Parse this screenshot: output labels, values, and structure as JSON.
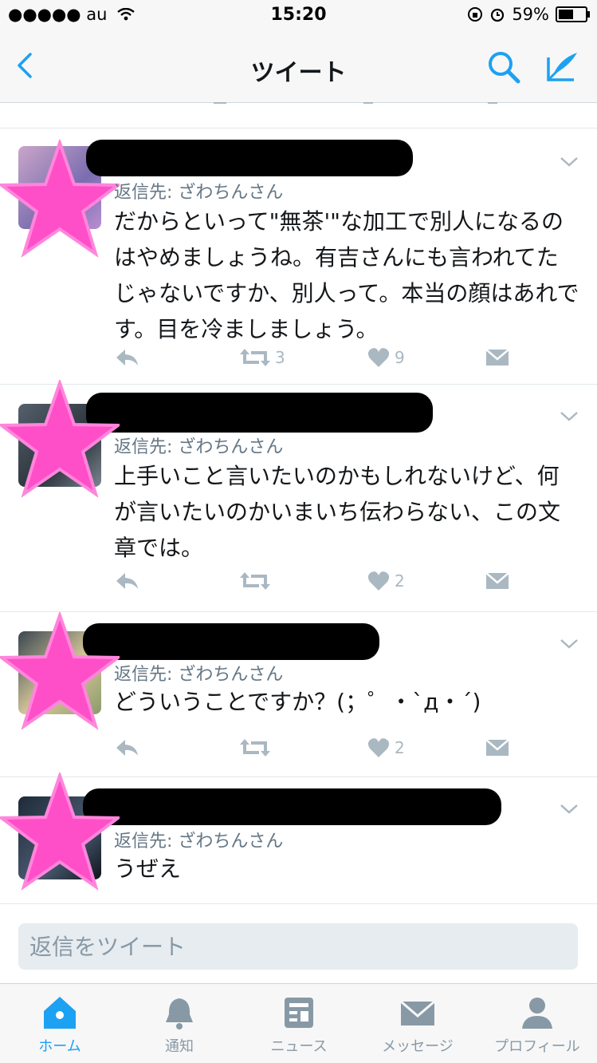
{
  "status": {
    "carrier": "●●●●● au",
    "time": "15:20",
    "battery": "59%",
    "battery_level": 0.59
  },
  "nav": {
    "title": "ツイート"
  },
  "tweets": [
    {
      "reply_to": "返信先: ざわちんさん",
      "text": "だからといって\"無茶'\"な加工で別人になるのはやめましょうね。有吉さんにも言われてたじゃないですか、別人って。本当の顔はあれです。目を冷ましましょう。",
      "retweets": "3",
      "likes": "9"
    },
    {
      "reply_to": "返信先: ざわちんさん",
      "text": "上手いこと言いたいのかもしれないけど、何が言いたいのかいまいち伝わらない、この文章では。",
      "retweets": "",
      "likes": "2"
    },
    {
      "reply_to": "返信先: ざわちんさん",
      "text": "どういうことですか？(；゜・`д・´)",
      "retweets": "",
      "likes": "2"
    },
    {
      "reply_to": "返信先: ざわちんさん",
      "text": "うぜえ",
      "retweets": "",
      "likes": ""
    }
  ],
  "reply_box": {
    "placeholder": "返信をツイート"
  },
  "tabs": [
    {
      "label": "ホーム",
      "icon": "home-icon"
    },
    {
      "label": "通知",
      "icon": "bell-icon"
    },
    {
      "label": "ニュース",
      "icon": "news-icon"
    },
    {
      "label": "メッセージ",
      "icon": "envelope-icon"
    },
    {
      "label": "プロフィール",
      "icon": "person-icon"
    }
  ],
  "colors": {
    "accent": "#1da1f2",
    "star": "#ff4fc8",
    "muted": "#aab8c2"
  }
}
